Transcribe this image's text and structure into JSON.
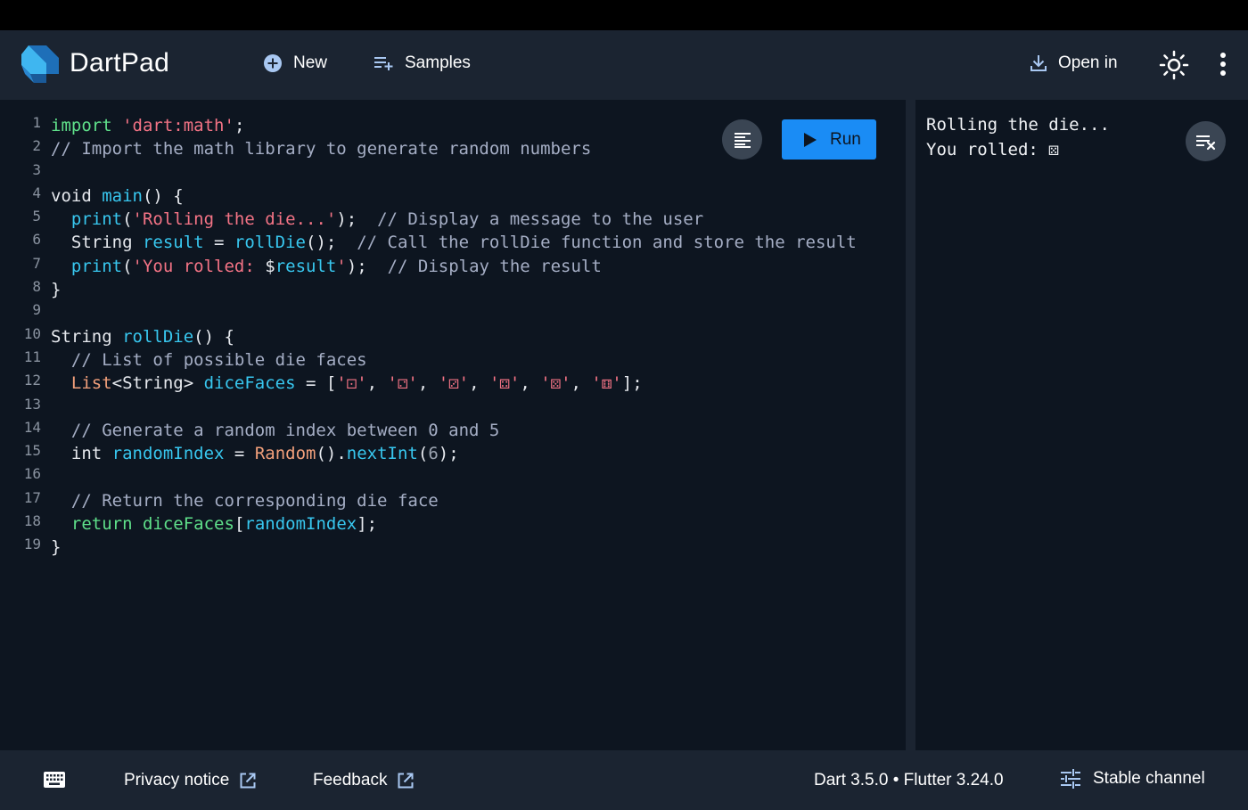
{
  "app": {
    "title": "DartPad"
  },
  "header": {
    "new_label": "New",
    "samples_label": "Samples",
    "open_in_label": "Open in"
  },
  "editor": {
    "run_label": "Run",
    "lines": [
      {
        "n": "1",
        "tokens": [
          {
            "t": "import",
            "c": "kw"
          },
          {
            "t": " ",
            "c": ""
          },
          {
            "t": "'dart:math'",
            "c": "str"
          },
          {
            "t": ";",
            "c": ""
          }
        ]
      },
      {
        "n": "2",
        "tokens": [
          {
            "t": "// Import the math library to generate random numbers",
            "c": "com"
          }
        ]
      },
      {
        "n": "3",
        "tokens": []
      },
      {
        "n": "4",
        "tokens": [
          {
            "t": "void ",
            "c": ""
          },
          {
            "t": "main",
            "c": "fn"
          },
          {
            "t": "() {",
            "c": ""
          }
        ]
      },
      {
        "n": "5",
        "tokens": [
          {
            "t": "  ",
            "c": ""
          },
          {
            "t": "print",
            "c": "fn"
          },
          {
            "t": "(",
            "c": ""
          },
          {
            "t": "'Rolling the die...'",
            "c": "str"
          },
          {
            "t": ");  ",
            "c": ""
          },
          {
            "t": "// Display a message to the user",
            "c": "com"
          }
        ]
      },
      {
        "n": "6",
        "tokens": [
          {
            "t": "  String ",
            "c": ""
          },
          {
            "t": "result",
            "c": "fn"
          },
          {
            "t": " = ",
            "c": ""
          },
          {
            "t": "rollDie",
            "c": "fn"
          },
          {
            "t": "();  ",
            "c": ""
          },
          {
            "t": "// Call the rollDie function and store the result",
            "c": "com"
          }
        ]
      },
      {
        "n": "7",
        "tokens": [
          {
            "t": "  ",
            "c": ""
          },
          {
            "t": "print",
            "c": "fn"
          },
          {
            "t": "(",
            "c": ""
          },
          {
            "t": "'You rolled: ",
            "c": "str"
          },
          {
            "t": "$",
            "c": ""
          },
          {
            "t": "result",
            "c": "fn"
          },
          {
            "t": "'",
            "c": "str"
          },
          {
            "t": ");  ",
            "c": ""
          },
          {
            "t": "// Display the result",
            "c": "com"
          }
        ]
      },
      {
        "n": "8",
        "tokens": [
          {
            "t": "}",
            "c": ""
          }
        ]
      },
      {
        "n": "9",
        "tokens": []
      },
      {
        "n": "10",
        "tokens": [
          {
            "t": "String ",
            "c": ""
          },
          {
            "t": "rollDie",
            "c": "fn"
          },
          {
            "t": "() {",
            "c": ""
          }
        ]
      },
      {
        "n": "11",
        "tokens": [
          {
            "t": "  ",
            "c": ""
          },
          {
            "t": "// List of possible die faces",
            "c": "com"
          }
        ]
      },
      {
        "n": "12",
        "tokens": [
          {
            "t": "  ",
            "c": ""
          },
          {
            "t": "List",
            "c": "type"
          },
          {
            "t": "<String> ",
            "c": ""
          },
          {
            "t": "diceFaces",
            "c": "fn"
          },
          {
            "t": " = [",
            "c": ""
          },
          {
            "t": "'⚀'",
            "c": "str"
          },
          {
            "t": ", ",
            "c": ""
          },
          {
            "t": "'⚁'",
            "c": "str"
          },
          {
            "t": ", ",
            "c": ""
          },
          {
            "t": "'⚂'",
            "c": "str"
          },
          {
            "t": ", ",
            "c": ""
          },
          {
            "t": "'⚃'",
            "c": "str"
          },
          {
            "t": ", ",
            "c": ""
          },
          {
            "t": "'⚄'",
            "c": "str"
          },
          {
            "t": ", ",
            "c": ""
          },
          {
            "t": "'⚅'",
            "c": "str"
          },
          {
            "t": "];",
            "c": ""
          }
        ]
      },
      {
        "n": "13",
        "tokens": []
      },
      {
        "n": "14",
        "tokens": [
          {
            "t": "  ",
            "c": ""
          },
          {
            "t": "// Generate a random index between 0 and 5",
            "c": "com"
          }
        ]
      },
      {
        "n": "15",
        "tokens": [
          {
            "t": "  int ",
            "c": ""
          },
          {
            "t": "randomIndex",
            "c": "fn"
          },
          {
            "t": " = ",
            "c": ""
          },
          {
            "t": "Random",
            "c": "type"
          },
          {
            "t": "().",
            "c": ""
          },
          {
            "t": "nextInt",
            "c": "fn"
          },
          {
            "t": "(",
            "c": ""
          },
          {
            "t": "6",
            "c": "num"
          },
          {
            "t": ");",
            "c": ""
          }
        ]
      },
      {
        "n": "16",
        "tokens": []
      },
      {
        "n": "17",
        "tokens": [
          {
            "t": "  ",
            "c": ""
          },
          {
            "t": "// Return the corresponding die face",
            "c": "com"
          }
        ]
      },
      {
        "n": "18",
        "tokens": [
          {
            "t": "  ",
            "c": ""
          },
          {
            "t": "return",
            "c": "kw"
          },
          {
            "t": " ",
            "c": ""
          },
          {
            "t": "diceFaces",
            "c": "kw"
          },
          {
            "t": "[",
            "c": ""
          },
          {
            "t": "randomIndex",
            "c": "fn"
          },
          {
            "t": "];",
            "c": ""
          }
        ]
      },
      {
        "n": "19",
        "tokens": [
          {
            "t": "}",
            "c": ""
          }
        ]
      }
    ]
  },
  "output": {
    "lines": [
      "Rolling the die...",
      "You rolled: ⚄"
    ]
  },
  "footer": {
    "privacy_label": "Privacy notice",
    "feedback_label": "Feedback",
    "version_text": "Dart 3.5.0 • Flutter 3.24.0",
    "channel_label": "Stable channel"
  },
  "colors": {
    "run_button": "#1a8cf5",
    "header_bg": "#1b2431",
    "editor_bg": "#0d1520"
  },
  "icons": {
    "logo": "dart-logo-icon",
    "new": "add-circle-icon",
    "samples": "playlist-add-icon",
    "open_in": "download-icon",
    "theme": "sun-icon",
    "more": "more-vert-icon",
    "format": "format-align-icon",
    "run": "play-icon",
    "clear": "clear-output-icon",
    "keyboard": "keyboard-icon",
    "external": "open-external-icon",
    "channel": "tune-icon"
  }
}
